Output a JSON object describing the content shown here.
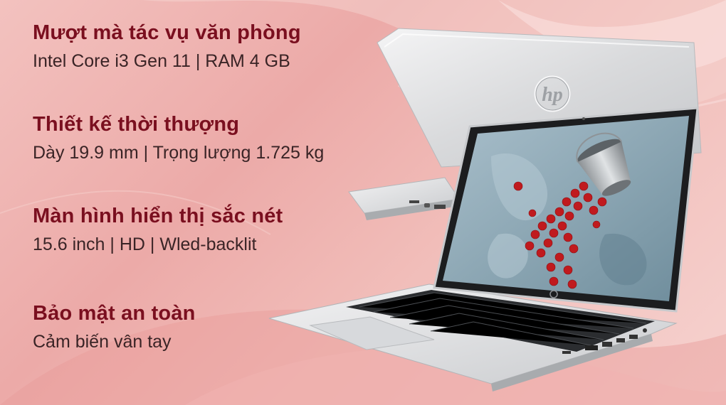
{
  "colors": {
    "heading": "#7a0f1f",
    "subtext": "#3a2426",
    "background": "#eeb3b0"
  },
  "features": [
    {
      "title": "Mượt mà tác vụ văn phòng",
      "detail": "Intel Core i3 Gen 11 | RAM 4 GB"
    },
    {
      "title": "Thiết kế thời thượng",
      "detail": "Dày 19.9 mm | Trọng lượng 1.725 kg"
    },
    {
      "title": "Màn hình hiển thị sắc nét",
      "detail": "15.6 inch | HD | Wled-backlit"
    },
    {
      "title": "Bảo mật an toàn",
      "detail": "Cảm biến vân tay"
    }
  ],
  "product": {
    "icon": "hp-laptop-image",
    "logo": "hp"
  }
}
